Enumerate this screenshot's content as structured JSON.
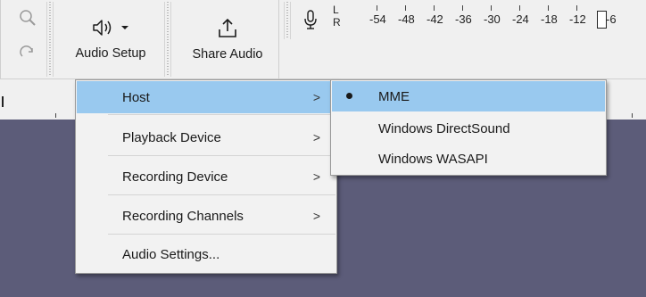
{
  "toolbar": {
    "audio_setup_label": "Audio Setup",
    "share_audio_label": "Share Audio",
    "meter": {
      "channel_top": "L",
      "channel_bottom": "R",
      "scale_labels": [
        "-54",
        "-48",
        "-42",
        "-36",
        "-30",
        "-24",
        "-18",
        "-12",
        "-6"
      ]
    }
  },
  "audio_setup_menu": {
    "items": [
      {
        "label": "Host",
        "has_submenu": ">",
        "highlighted": true
      },
      {
        "label": "Playback Device",
        "has_submenu": ">"
      },
      {
        "label": "Recording Device",
        "has_submenu": ">"
      },
      {
        "label": "Recording Channels",
        "has_submenu": ">"
      },
      {
        "label": "Audio Settings..."
      }
    ]
  },
  "host_submenu": {
    "items": [
      {
        "label": "MME",
        "selected": true
      },
      {
        "label": "Windows DirectSound"
      },
      {
        "label": "Windows WASAPI"
      }
    ]
  },
  "colors": {
    "menu_highlight": "#99c9ef",
    "track_background": "#5c5c79",
    "toolbar_background": "#f0f0f0"
  }
}
